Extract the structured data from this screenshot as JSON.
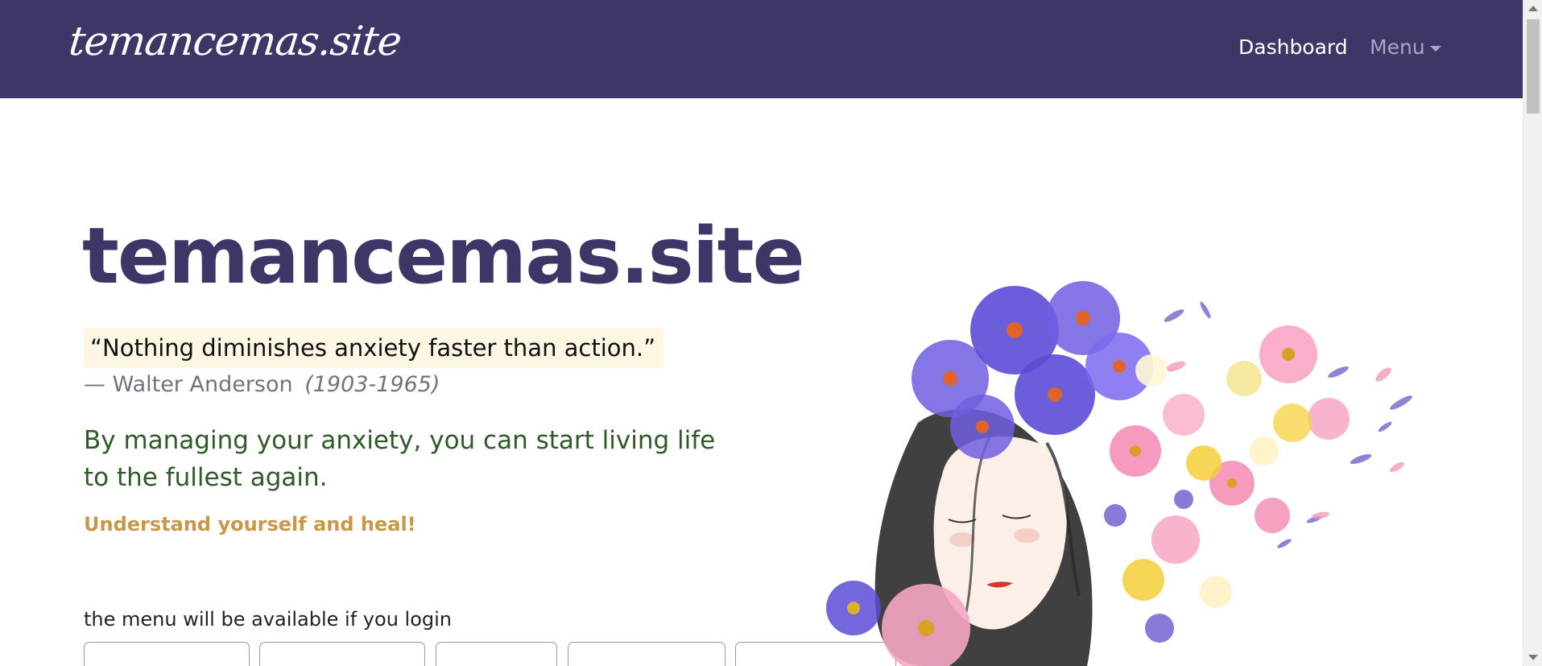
{
  "navbar": {
    "brand": "temancemas.site",
    "links": [
      {
        "label": "Dashboard"
      },
      {
        "label": "Menu"
      }
    ]
  },
  "hero": {
    "title": "temancemas.site",
    "quote": "“Nothing diminishes anxiety faster than action.”",
    "author_dash": "—",
    "author": "Walter Anderson",
    "author_years": "(1903-1965)",
    "lead": "By managing your anxiety, you can start living life to the fullest again.",
    "tagline": "Understand yourself and heal!",
    "login_note": "the menu will be available if you login"
  },
  "colors": {
    "navbar": "#3d3666",
    "title": "#3d3666",
    "lead": "#2e5a27",
    "tagline": "#c9964a",
    "quote_bg": "#fdf6e3"
  },
  "illustration": {
    "icon": "woman-with-flowers-illustration"
  }
}
